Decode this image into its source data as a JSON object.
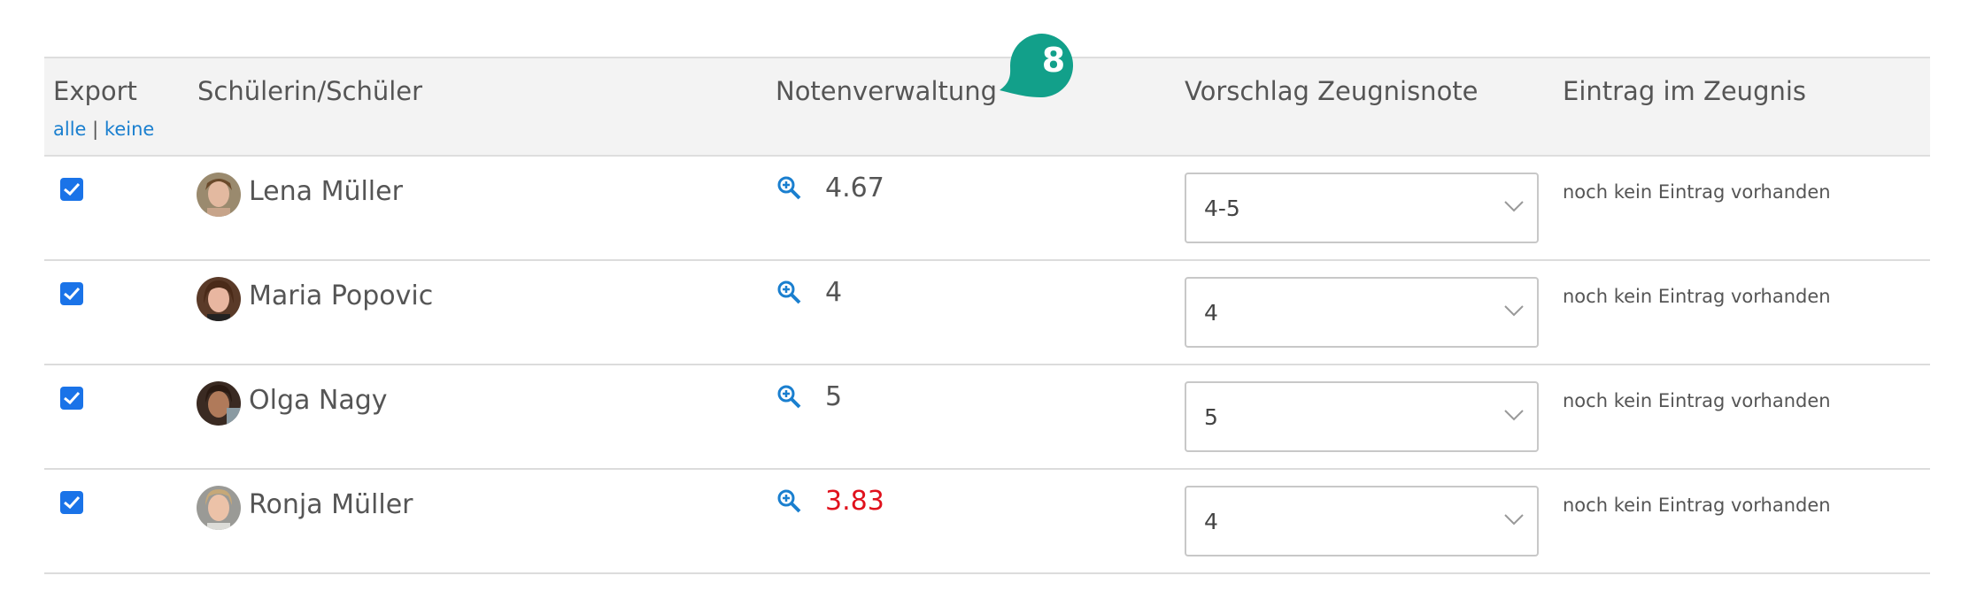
{
  "header": {
    "export": "Export",
    "export_all": "alle",
    "export_sep": "|",
    "export_none": "keine",
    "student": "Schülerin/Schüler",
    "grades": "Notenverwaltung",
    "suggestion": "Vorschlag Zeugnisnote",
    "entry": "Eintrag im Zeugnis"
  },
  "badge": {
    "number": "8",
    "color": "#12a08a"
  },
  "colors": {
    "link": "#1a7fcf",
    "warning": "#e0111c",
    "checkbox": "#1a73e8"
  },
  "rows": [
    {
      "name": "Lena Müller",
      "average": "4.67",
      "average_warning": false,
      "suggestion": "4-5",
      "entry": "noch kein Eintrag vorhanden",
      "export": true
    },
    {
      "name": "Maria Popovic",
      "average": "4",
      "average_warning": false,
      "suggestion": "4",
      "entry": "noch kein Eintrag vorhanden",
      "export": true
    },
    {
      "name": "Olga Nagy",
      "average": "5",
      "average_warning": false,
      "suggestion": "5",
      "entry": "noch kein Eintrag vorhanden",
      "export": true
    },
    {
      "name": "Ronja Müller",
      "average": "3.83",
      "average_warning": true,
      "suggestion": "4",
      "entry": "noch kein Eintrag vorhanden",
      "export": true
    }
  ],
  "icons": {
    "zoom": "zoom-in-icon",
    "checkbox": "checkmark-icon",
    "select": "chevron-down-icon"
  }
}
